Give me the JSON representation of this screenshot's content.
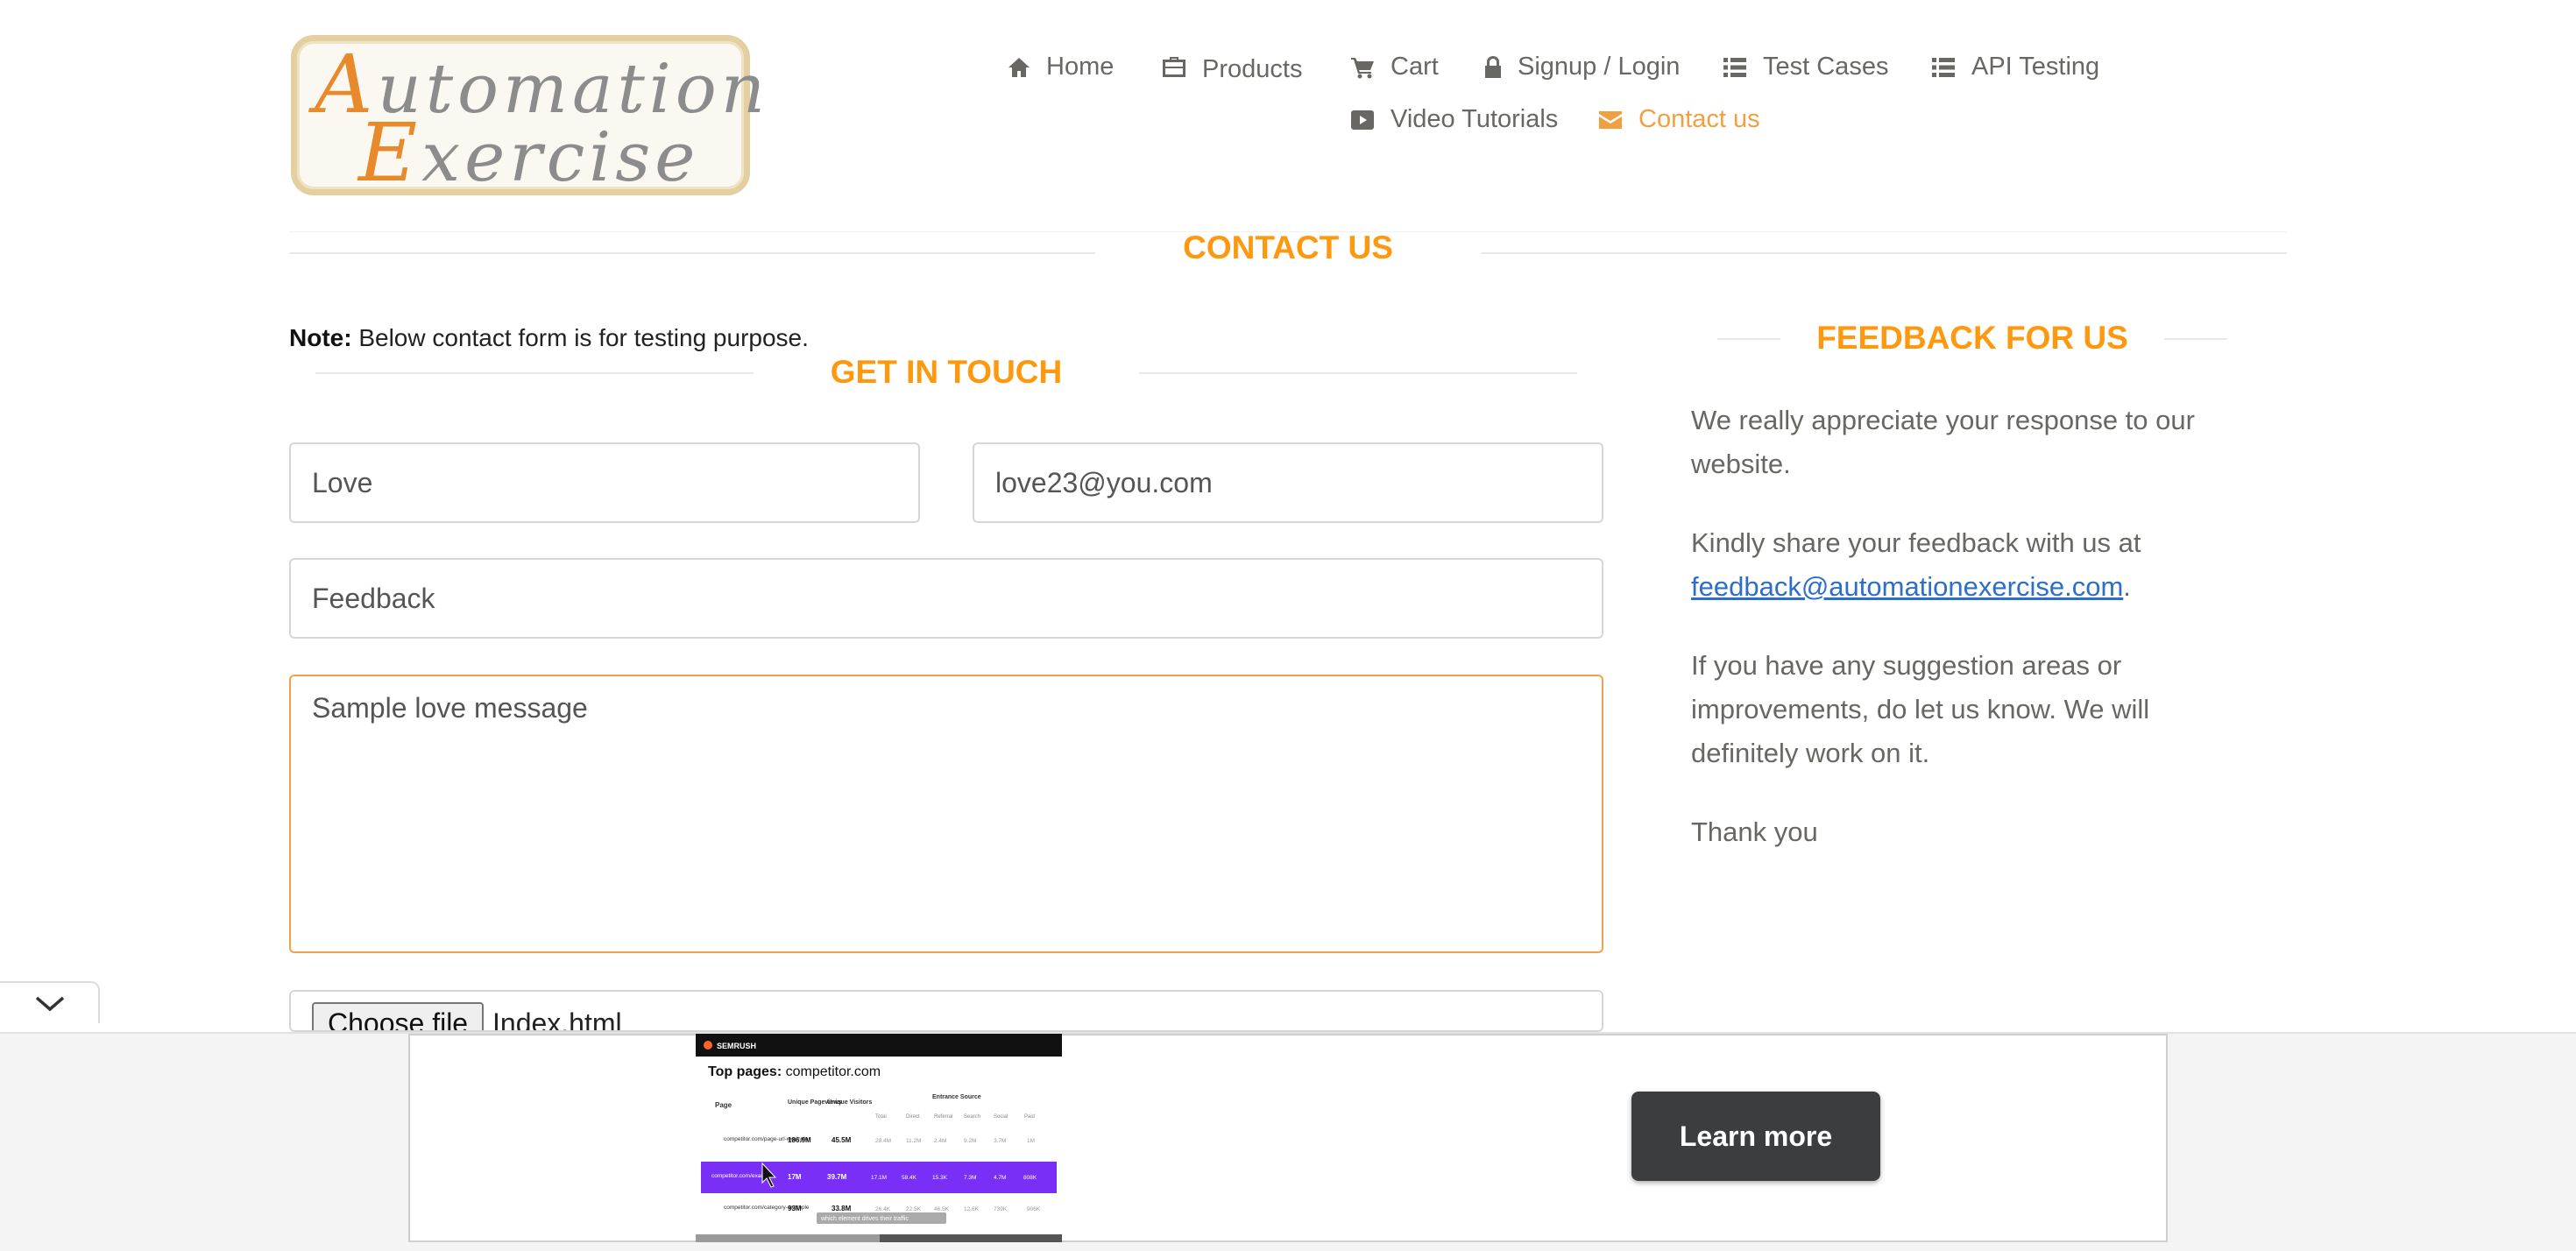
{
  "logo": {
    "line1_cap": "A",
    "line1_rest": "utomation",
    "line2_cap": "E",
    "line2_rest": "xercise"
  },
  "nav": {
    "items": [
      {
        "label": "Home",
        "icon": "home-icon"
      },
      {
        "label": "Products",
        "icon": "briefcase-icon"
      },
      {
        "label": "Cart",
        "icon": "cart-icon"
      },
      {
        "label": "Signup / Login",
        "icon": "lock-icon"
      },
      {
        "label": "Test Cases",
        "icon": "list-icon"
      },
      {
        "label": "API Testing",
        "icon": "list-icon"
      },
      {
        "label": "Video Tutorials",
        "icon": "youtube-icon"
      },
      {
        "label": "Contact us",
        "icon": "envelope-icon",
        "active": true
      }
    ],
    "active_color": "#f0a040"
  },
  "page": {
    "title": "CONTACT US"
  },
  "note": {
    "bold": "Note:",
    "text": " Below contact form is for testing purpose."
  },
  "form": {
    "title": "GET IN TOUCH",
    "name_value": "Love",
    "email_value": "love23@you.com",
    "subject_value": "Feedback",
    "message_value": "Sample love message",
    "file_button": "Choose file",
    "file_name": "Index.html"
  },
  "feedback": {
    "title": "FEEDBACK FOR US",
    "p1": "We really appreciate your response to our website.",
    "p2_prefix": "Kindly share your feedback with us at ",
    "p2_link": "feedback@automationexercise.com",
    "p2_suffix": ".",
    "p3": "If you have any suggestion areas or improvements, do let us know. We will definitely work on it.",
    "p4": "Thank you"
  },
  "ad": {
    "brand": "SEMRUSH",
    "heading_bold": "Top pages:",
    "heading_rest": " competitor.com",
    "col_page": "Page",
    "col_pageviews": "Unique Pageviews",
    "col_visitors": "Unique Visitors",
    "col_entrance": "Entrance Source",
    "sub_cols": [
      "Total",
      "Direct",
      "Referral",
      "Search",
      "Social",
      "Paid"
    ],
    "rows": [
      {
        "page": "competitor.com/page-url-example",
        "pageviews": "186.9M",
        "visitors": "45.5M",
        "cells": [
          "28.4M",
          "11.2M",
          "2.4M",
          "9.2M",
          "3.7M",
          "1M"
        ]
      },
      {
        "page": "competitor.com/example",
        "pageviews": "17M",
        "visitors": "39.7M",
        "cells": [
          "17.1M",
          "58.4K",
          "15.3K",
          "7.3M",
          "4.7M",
          "808K"
        ]
      },
      {
        "page": "competitor.com/category-example",
        "pageviews": "93M",
        "visitors": "33.8M",
        "cells": [
          "26.4K",
          "22.5K",
          "46.5K",
          "12.6K",
          "739K",
          "906K"
        ]
      }
    ],
    "tooltip": "which element drives their traffic",
    "cta": "Learn more",
    "accent": "#7a2ff7"
  }
}
